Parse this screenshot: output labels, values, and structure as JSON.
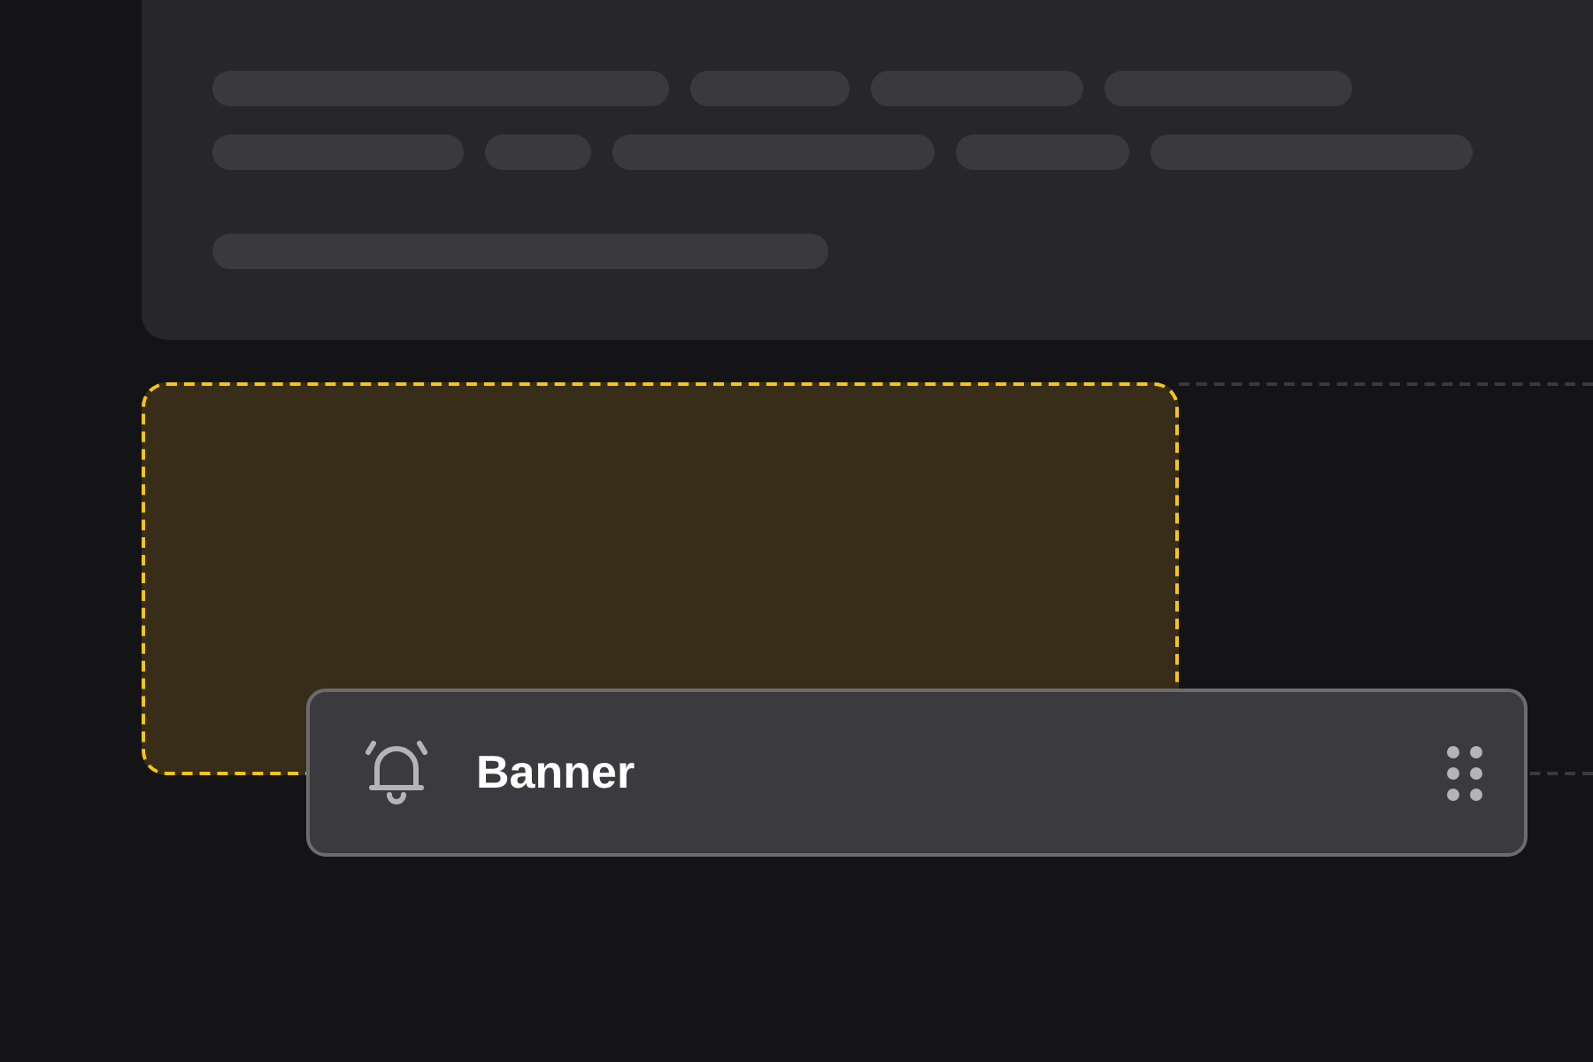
{
  "drop_zone": {
    "highlighted": true
  },
  "drag_item": {
    "label": "Banner"
  }
}
